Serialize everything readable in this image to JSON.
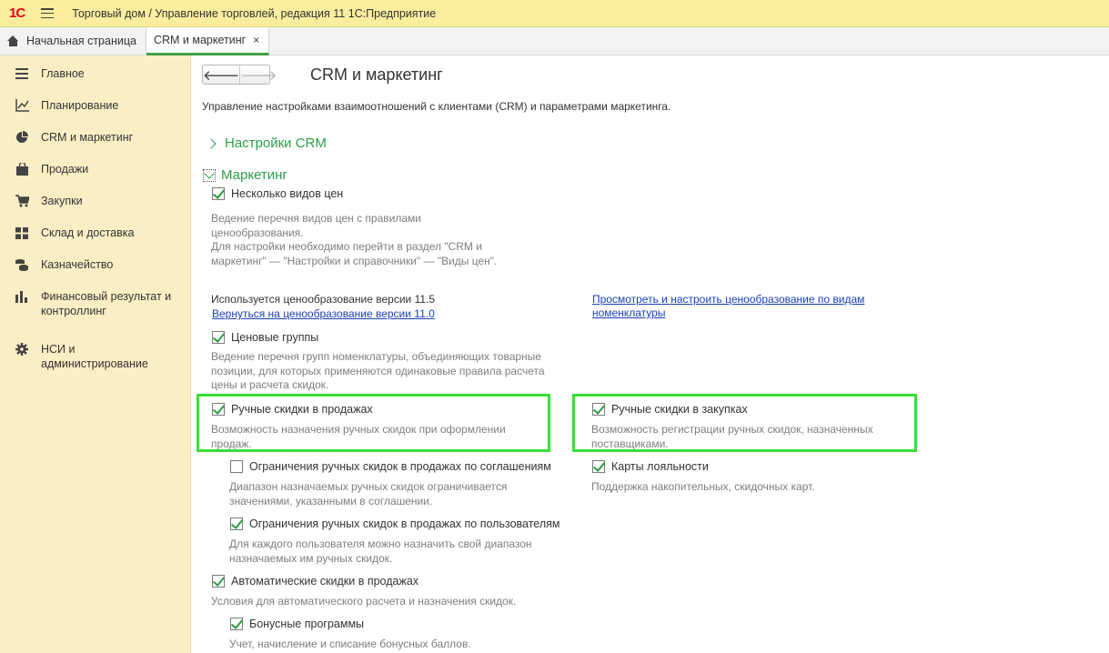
{
  "window": {
    "logo": "1С",
    "title": "Торговый дом / Управление торговлей, редакция 11 1С:Предприятие"
  },
  "tabs": [
    {
      "label": "Начальная страница"
    },
    {
      "label": "CRM и маркетинг",
      "close": "×"
    }
  ],
  "sidebar": {
    "items": [
      {
        "label": "Главное"
      },
      {
        "label": "Планирование"
      },
      {
        "label": "CRM и маркетинг"
      },
      {
        "label": "Продажи"
      },
      {
        "label": "Закупки"
      },
      {
        "label": "Склад и доставка"
      },
      {
        "label": "Казначейство"
      },
      {
        "label": "Финансовый результат и контроллинг"
      },
      {
        "label": "НСИ и администрирование"
      }
    ]
  },
  "page": {
    "nav_back": "🡐",
    "nav_forward": "🡒",
    "title": "CRM и маркетинг",
    "description": "Управление настройками взаимоотношений с клиентами (CRM) и параметрами маркетинга."
  },
  "sections": {
    "crm": "Настройки CRM",
    "marketing": "Маркетинг"
  },
  "options": {
    "multi_prices": {
      "label": "Несколько видов цен",
      "checked": true,
      "hint": "Ведение перечня видов цен с правилами\nценообразования.\nДля настройки необходимо перейти в раздел \"CRM и\nмаркетинг\" — \"Настройки и справочники\" — \"Виды цен\"."
    },
    "pricing_version": "Используется ценообразование версии 11.5",
    "revert_link": "Вернуться на ценообразование версии 11.0",
    "view_pricing_link": "Просмотреть и настроить ценообразование по видам\nноменклатуры",
    "price_groups": {
      "label": "Ценовые группы",
      "checked": true,
      "hint": "Ведение перечня групп номенклатуры, объединяющих товарные\nпозиции, для которых применяются одинаковые правила расчета\nцены и расчета скидок."
    },
    "manual_sales": {
      "label": "Ручные скидки в продажах",
      "checked": true,
      "hint": "Возможность назначения ручных скидок при оформлении\nпродаж."
    },
    "manual_purchases": {
      "label": "Ручные скидки в закупках",
      "checked": true,
      "hint": "Возможность регистрации ручных скидок, назначенных\nпоставщиками."
    },
    "limit_agreements": {
      "label": "Ограничения ручных скидок в продажах по соглашениям",
      "checked": false,
      "hint": "Диапазон назначаемых ручных скидок ограничивается\nзначениями, указанными в соглашении."
    },
    "loyalty_cards": {
      "label": "Карты лояльности",
      "checked": true,
      "hint": "Поддержка накопительных, скидочных карт."
    },
    "limit_users": {
      "label": "Ограничения ручных скидок в продажах по пользователям",
      "checked": true,
      "hint": "Для каждого пользователя можно назначить свой диапазон\nназначаемых им ручных скидок."
    },
    "auto_discounts": {
      "label": "Автоматические скидки в продажах",
      "checked": true,
      "hint": "Условия для автоматического расчета и назначения скидок."
    },
    "bonus": {
      "label": "Бонусные программы",
      "checked": true,
      "hint": "Учет, начисление и списание бонусных баллов."
    }
  },
  "colors": {
    "accent_green": "#2b9e48",
    "highlight": "#3ae03a",
    "sidebar_bg": "#fbeec5",
    "titlebar_bg": "#fbed9e",
    "link_blue": "#1a3fb7"
  }
}
